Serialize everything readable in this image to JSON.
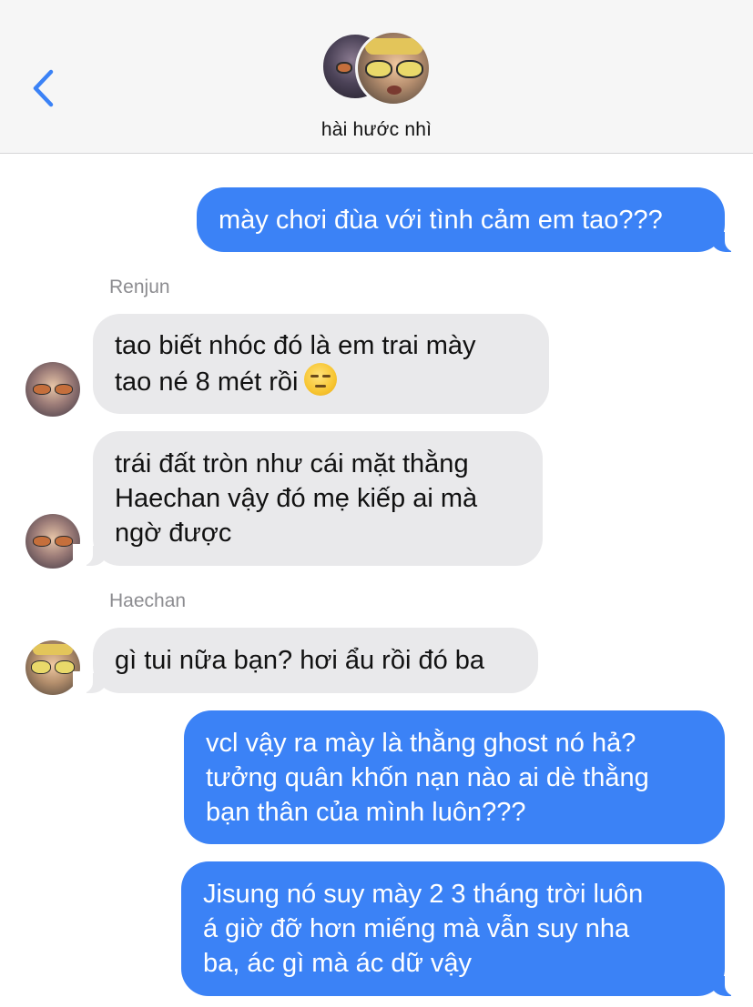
{
  "header": {
    "back_icon": "chevron-left-icon",
    "group_name": "hài hước nhì",
    "accent_color": "#3b82f6"
  },
  "messages": [
    {
      "direction": "outgoing",
      "lines": [
        "mày chơi đùa với tình cảm em tao???"
      ]
    },
    {
      "direction": "incoming",
      "sender": "Renjun",
      "lines": [
        "tao biết nhóc đó là em trai mày",
        "tao né 8 mét rồi"
      ],
      "emoji": "unamused-face-icon"
    },
    {
      "direction": "incoming",
      "lines": [
        "trái đất tròn như cái mặt thằng",
        "Haechan vậy đó mẹ kiếp ai mà",
        "ngờ được"
      ]
    },
    {
      "direction": "incoming",
      "sender": "Haechan",
      "lines": [
        "gì tui nữa bạn? hơi ẩu rồi đó ba"
      ]
    },
    {
      "direction": "outgoing",
      "lines": [
        "vcl vậy ra mày là thằng ghost nó hả?",
        "tưởng quân khốn nạn nào ai dè thằng",
        "bạn thân của mình luôn???"
      ]
    },
    {
      "direction": "outgoing",
      "lines": [
        "Jisung nó suy mày 2 3 tháng trời luôn",
        "á giờ đỡ hơn miếng mà vẫn suy nha",
        "ba, ác gì mà ác dữ vậy"
      ]
    }
  ],
  "colors": {
    "outgoing_bubble": "#3b82f6",
    "incoming_bubble": "#e9e9eb",
    "sender_name": "#8c8c90"
  }
}
